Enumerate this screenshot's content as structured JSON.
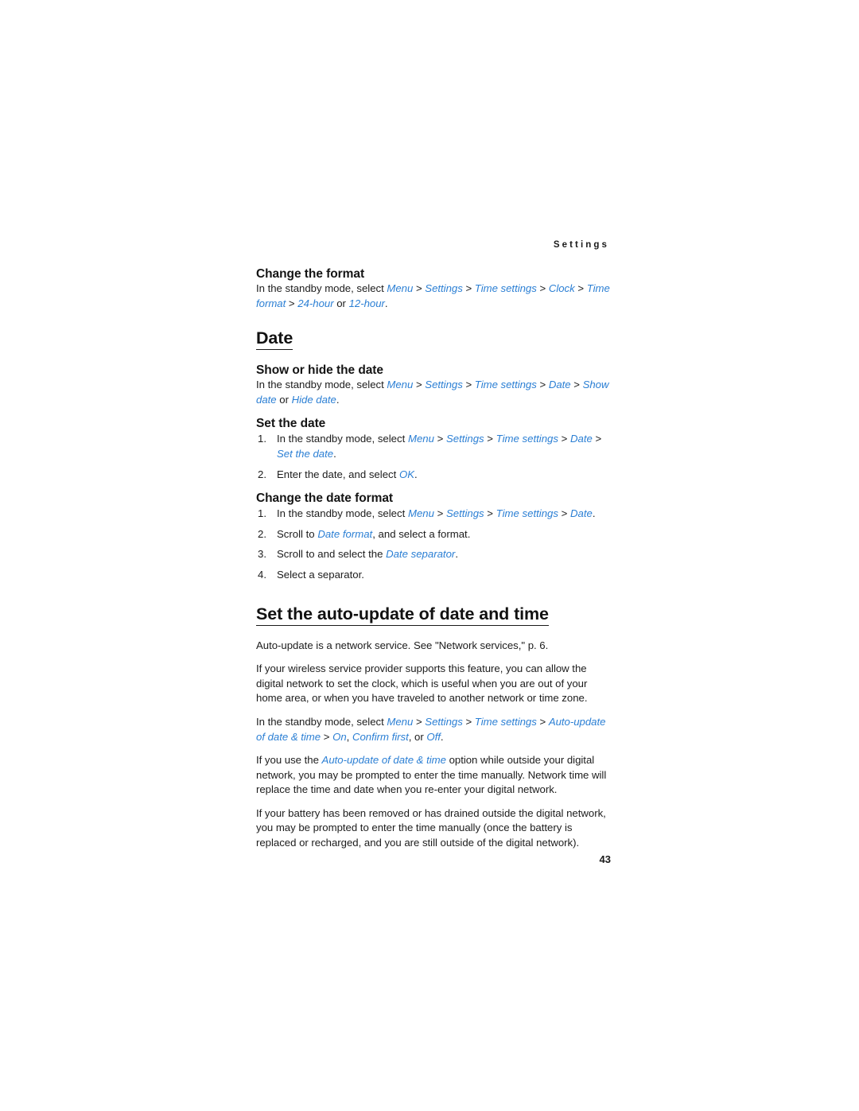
{
  "header": {
    "running_title": "Settings"
  },
  "sections": {
    "change_the_format": {
      "subhead": "Change the format",
      "line1_lead": "In the standby mode, select ",
      "ui_menu": "Menu",
      "ui_settings": "Settings",
      "ui_time_settings": "Time settings",
      "ui_clock": "Clock",
      "ui_time_format": "Time format",
      "ui_24hour": "24-hour",
      "ui_12hour": "12-hour",
      "word_or": "or",
      "sep": ">",
      "period": "."
    },
    "date": {
      "title": "Date",
      "show_or_hide": {
        "subhead": "Show or hide the date",
        "lead": "In the standby mode, select ",
        "ui_menu": "Menu",
        "ui_settings": "Settings",
        "ui_time_settings": "Time settings",
        "ui_date": "Date",
        "ui_show_date": "Show date",
        "word_or": "or ",
        "ui_hide_date": "Hide date",
        "period": "."
      },
      "set_the_date": {
        "subhead": "Set the date",
        "step1_lead": "In the standby mode, select ",
        "step1_ui_menu": "Menu",
        "step1_ui_settings": "Settings",
        "step1_ui_time_settings": "Time settings",
        "step1_ui_date": "Date",
        "step1_ui_set_the_date": "Set the date",
        "step2_lead": "Enter the date, and select ",
        "step2_ui_ok": "OK",
        "period": "."
      },
      "change_date_format": {
        "subhead": "Change the date format",
        "step1_lead": "In the standby mode, select ",
        "step1_ui_menu": "Menu",
        "step1_ui_settings": "Settings",
        "step1_ui_time_settings": "Time settings",
        "step1_ui_date": "Date",
        "step2_lead": "Scroll to ",
        "step2_ui_date_format": "Date format",
        "step2_tail": ", and select a format.",
        "step3_lead": "Scroll to and select the ",
        "step3_ui_date_separator": "Date separator",
        "step4": "Select a separator.",
        "period": "."
      }
    },
    "auto_update": {
      "title": "Set the auto-update of date and time",
      "para_network_service": "Auto-update is a network service. See \"Network services,\" p. 6.",
      "para_provider": "If your wireless service provider supports this feature, you can allow the digital network to set the clock, which is useful when you are out of your home area, or when you have traveled to another network or time zone.",
      "path": {
        "lead": "In the standby mode, select ",
        "ui_menu": "Menu",
        "ui_settings": "Settings",
        "ui_time_settings": "Time settings",
        "ui_auto_update": "Auto-update of date & time",
        "ui_on": "On",
        "ui_confirm_first": "Confirm first",
        "ui_off": "Off",
        "comma": ", ",
        "word_or": "or ",
        "period": "."
      },
      "para_outside": {
        "lead": "If you use the ",
        "ui_auto_update": "Auto-update of date & time",
        "tail": " option while outside your digital network, you may be prompted to enter the time manually. Network time will replace the time and date when you re-enter your digital network."
      },
      "para_battery": "If your battery has been removed or has drained outside the digital network, you may be prompted to enter the time manually (once the battery is replaced or recharged, and you are still outside of the digital network)."
    }
  },
  "footer": {
    "page_number": "43"
  },
  "colors": {
    "ui_reference_blue": "#2b7fd4",
    "text_black": "#1c1c1c",
    "page_background": "#ffffff"
  }
}
